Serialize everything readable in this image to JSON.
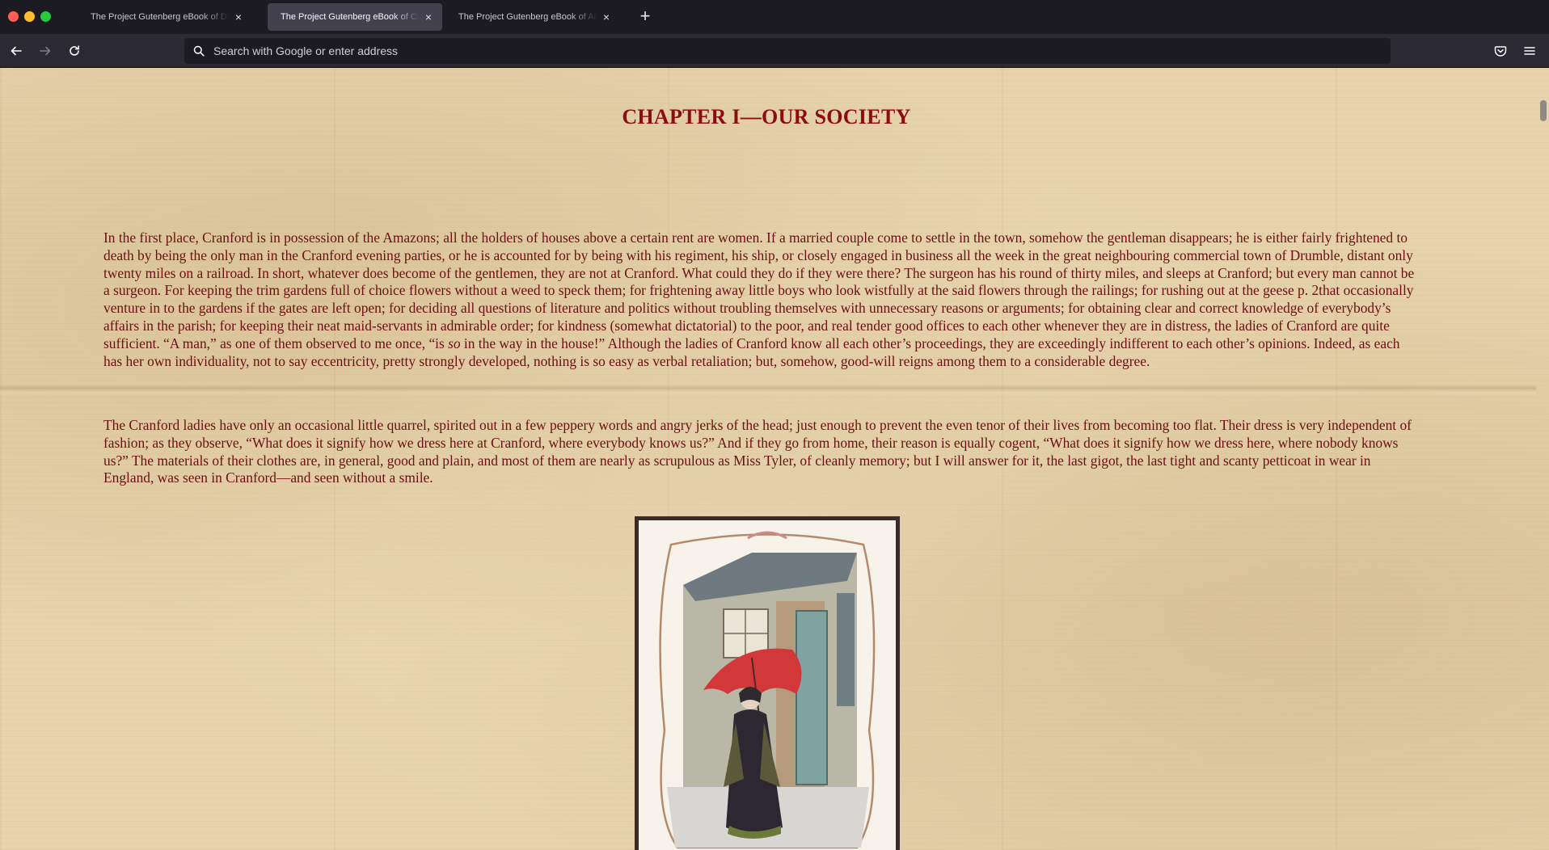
{
  "browser": {
    "tabs": [
      {
        "title": "The Project Gutenberg eBook of Dracula",
        "active": false
      },
      {
        "title": "The Project Gutenberg eBook of Cranford",
        "active": true
      },
      {
        "title": "The Project Gutenberg eBook of Anne of Green Gables",
        "active": false
      }
    ],
    "new_tab_label": "+",
    "close_glyph": "×",
    "url_placeholder": "Search with Google or enter address"
  },
  "page": {
    "chapter_title": "CHAPTER I—OUR SOCIETY",
    "paragraph1": {
      "before_italic": "In the first place, Cranford is in possession of the Amazons; all the holders of houses above a certain rent are women.  If a married couple come to settle in the town, somehow the gentleman disappears; he is either fairly frightened to death by being the only man in the Cranford evening parties, or he is accounted for by being with his regiment, his ship, or closely engaged in business all the week in the great neighbouring commercial town of Drumble, distant only twenty miles on a railroad.  In short, whatever does become of the gentlemen, they are not at Cranford.  What could they do if they were there?  The surgeon has his round of thirty miles, and sleeps at Cranford; but every man cannot be a surgeon.  For keeping the trim gardens full of choice flowers without a weed to speck them; for frightening away little boys who look wistfully at the said flowers through the railings; for rushing out at the geese p. 2that occasionally venture in to the gardens if the gates are left open; for deciding all questions of literature and politics without troubling themselves with unnecessary reasons or arguments; for obtaining clear and correct knowledge of everybody’s affairs in the parish; for keeping their neat maid-servants in admirable order; for kindness (somewhat dictatorial) to the poor, and real tender good offices to each other whenever they are in distress, the ladies of Cranford are quite sufficient.  “A man,” as one of them observed to me once, “is ",
      "italic": "so",
      "after_italic": " in the way in the house!”  Although the ladies of Cranford know all each other’s proceedings, they are exceedingly indifferent to each other’s opinions.  Indeed, as each has her own individuality, not to say eccentricity, pretty strongly developed, nothing is so easy as verbal retaliation; but, somehow, good-will reigns among them to a considerable degree."
    },
    "paragraph2": "The Cranford ladies have only an occasional little quarrel, spirited out in a few peppery words and angry jerks of the head; just enough to prevent the even tenor of their lives from becoming too flat.  Their dress is very independent of fashion; as they observe, “What does it signify how we dress here at Cranford, where everybody knows us?”  And if they go from home, their reason is equally cogent, “What does it signify how we dress here, where nobody knows us?”  The materials of their clothes are, in general, good and plain, and most of them are nearly as scrupulous as Miss Tyler, of cleanly memory; but I will answer for it, the last gigot, the last tight and scanty petticoat in wear in England, was seen in Cranford—and seen without a smile."
  },
  "colors": {
    "heading": "#8b0d12",
    "body_text": "#6b0f12",
    "parchment": "#e6d3ac",
    "toolbar": "#2b2a33",
    "tabstrip": "#1c1b22",
    "umbrella": "#d2383a"
  },
  "icons": {
    "back": "arrow-left-icon",
    "forward": "arrow-right-icon",
    "reload": "reload-icon",
    "search": "search-icon",
    "pocket": "pocket-icon",
    "menu": "hamburger-menu-icon"
  }
}
